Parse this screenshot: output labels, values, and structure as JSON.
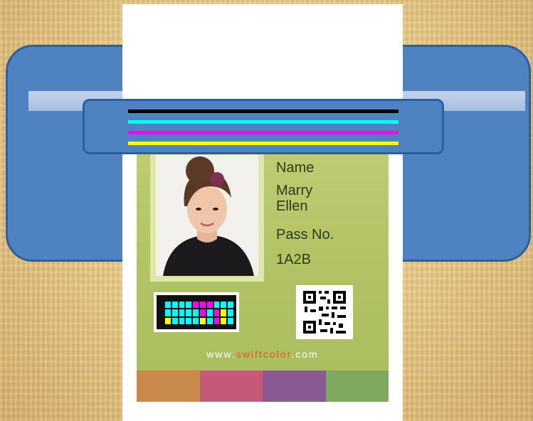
{
  "card": {
    "name_label": "Name",
    "name_line1": "Marry",
    "name_line2": "Ellen",
    "pass_label": "Pass No.",
    "pass_value": "1A2B",
    "url_prefix": "www.",
    "url_brand": "swiftcolor",
    "url_suffix": ".com"
  },
  "colors": {
    "printer_body": "#4e82c1",
    "ink_black": "#000000",
    "ink_cyan": "#00ffff",
    "ink_magenta": "#ff00ff",
    "ink_yellow": "#ffff00",
    "url_accent": "#e9542e",
    "swatches": [
      "#c9894a",
      "#c55a78",
      "#8b5a95",
      "#7ea95f"
    ]
  },
  "icons": [
    "cmyk-color-bar-icon",
    "qr-code-icon",
    "person-photo"
  ]
}
